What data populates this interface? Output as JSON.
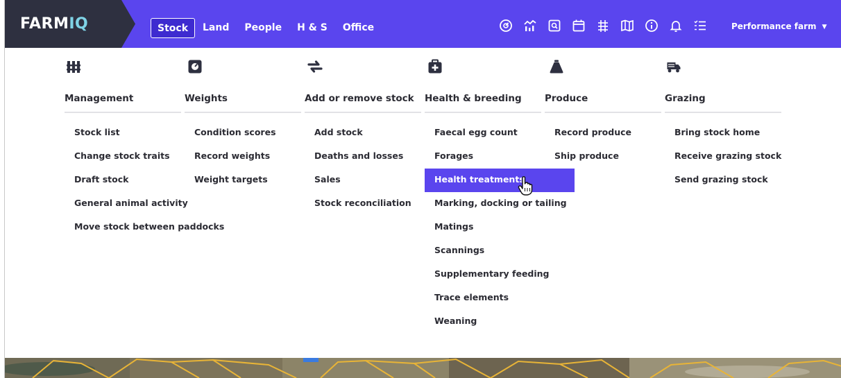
{
  "brand": {
    "name_part1": "FARM",
    "name_part2": "IQ"
  },
  "nav": {
    "tabs": [
      {
        "label": "Stock",
        "active": true
      },
      {
        "label": "Land"
      },
      {
        "label": "People"
      },
      {
        "label": "H & S"
      },
      {
        "label": "Office"
      }
    ],
    "icons": [
      "dashboard-icon",
      "analytics-icon",
      "search-records-icon",
      "calendar-icon",
      "feed-budget-icon",
      "map-icon",
      "info-icon",
      "notifications-icon",
      "task-list-icon"
    ],
    "farm_selector": "Performance farm"
  },
  "menu": {
    "columns": [
      {
        "title": "Management",
        "icon": "fence-icon",
        "items": [
          "Stock list",
          "Change stock traits",
          "Draft stock",
          "General animal activity",
          "Move stock between paddocks"
        ]
      },
      {
        "title": "Weights",
        "icon": "scale-icon",
        "items": [
          "Condition scores",
          "Record weights",
          "Weight targets"
        ]
      },
      {
        "title": "Add or remove stock",
        "icon": "swap-arrows-icon",
        "items": [
          "Add stock",
          "Deaths and losses",
          "Sales",
          "Stock reconciliation"
        ]
      },
      {
        "title": "Health & breeding",
        "icon": "first-aid-icon",
        "items": [
          "Faecal egg count",
          "Forages",
          "Health treatments",
          "Marking, docking or tailing",
          "Matings",
          "Scannings",
          "Supplementary feeding",
          "Trace elements",
          "Weaning"
        ]
      },
      {
        "title": "Produce",
        "icon": "wool-bale-icon",
        "items": [
          "Record produce",
          "Ship produce"
        ]
      },
      {
        "title": "Grazing",
        "icon": "stock-truck-icon",
        "items": [
          "Bring stock home",
          "Receive grazing stock",
          "Send grazing stock"
        ]
      }
    ],
    "hovered_item": "Health treatments"
  },
  "colors": {
    "nav_bg": "#5a45ee",
    "brand_bg": "#2e3040",
    "hover_bg": "#5a45ee",
    "text": "#2b2b33"
  }
}
